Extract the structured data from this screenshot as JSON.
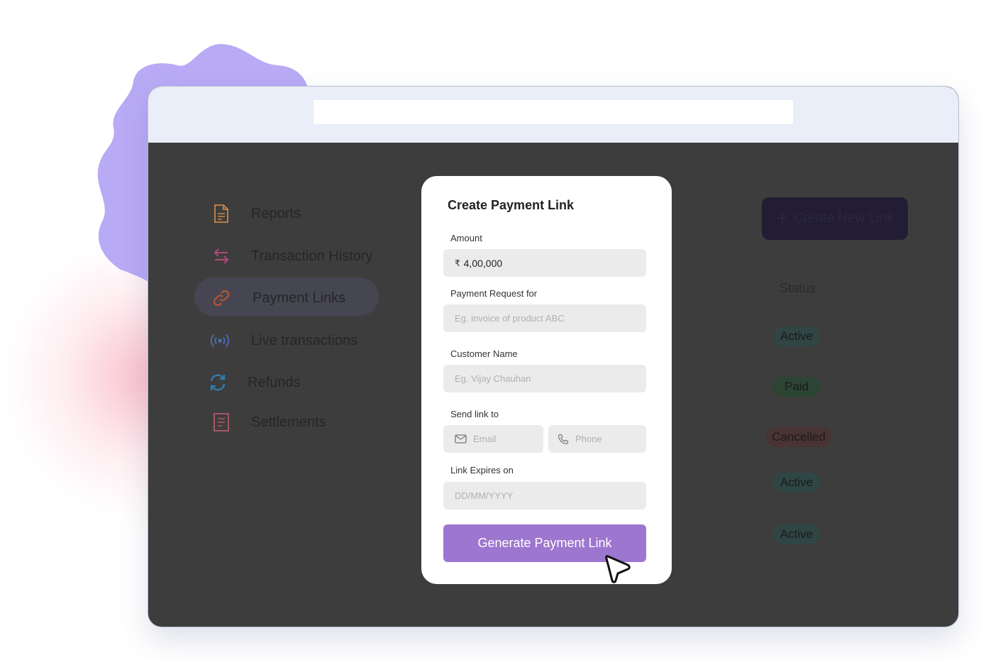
{
  "sidebar": {
    "items": [
      {
        "label": "Reports",
        "icon": "document-icon",
        "color": "#c9884a"
      },
      {
        "label": "Transaction History",
        "icon": "transfer-arrows-icon",
        "color": "#b04a7a"
      },
      {
        "label": "Payment Links",
        "icon": "link-icon",
        "color": "#b8552f",
        "active": true
      },
      {
        "label": "Live transactions",
        "icon": "broadcast-icon",
        "color": "#4a6db0"
      },
      {
        "label": "Refunds",
        "icon": "refresh-icon",
        "color": "#2f7fb0"
      },
      {
        "label": "Settlements",
        "icon": "ledger-icon",
        "color": "#b05a6a"
      }
    ]
  },
  "toolbar": {
    "create_link_label": "Create New Link"
  },
  "table": {
    "status_header": "Status",
    "statuses": [
      "Active",
      "Paid",
      "Cancelled",
      "Active",
      "Active"
    ]
  },
  "modal": {
    "title": "Create Payment Link",
    "amount": {
      "label": "Amount",
      "currency": "₹",
      "value": "4,00,000"
    },
    "request_for": {
      "label": "Payment Request for",
      "placeholder": "Eg. invoice of product ABC"
    },
    "customer_name": {
      "label": "Customer Name",
      "placeholder": "Eg. Vijay Chauhan"
    },
    "send_to": {
      "label": "Send link to",
      "email_placeholder": "Email",
      "phone_placeholder": "Phone"
    },
    "expires": {
      "label": "Link Expires on",
      "placeholder": "DD/MM/YYYY"
    },
    "submit_label": "Generate Payment Link"
  },
  "colors": {
    "accent": "#9d76cf",
    "blob": "#b9aaf5",
    "overlay": "#3d3d3d",
    "titlebar": "#eaeef8"
  }
}
